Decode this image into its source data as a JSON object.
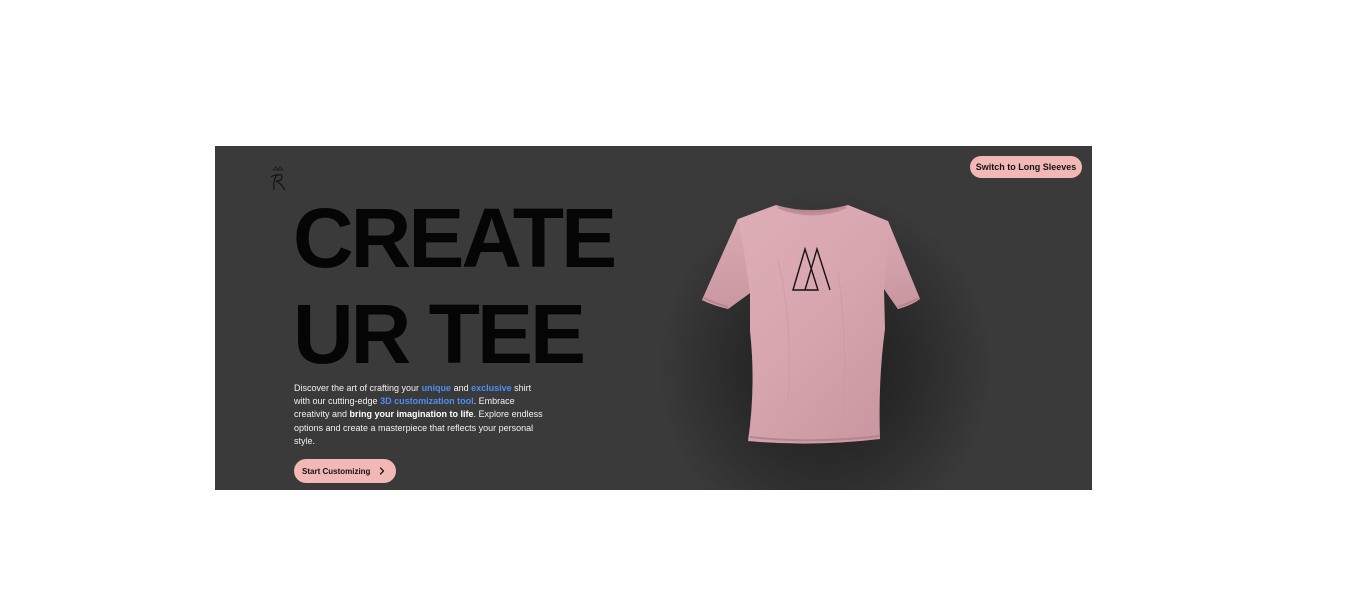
{
  "hero": {
    "headline_line1": "CREATE",
    "headline_line2": "UR TEE",
    "description": {
      "p1": "Discover the art of crafting your ",
      "unique": "unique",
      "p2": " and ",
      "exclusive": "exclusive",
      "p3": " shirt with our cutting-edge ",
      "tool": "3D customization tool",
      "p4": ". Embrace creativity and ",
      "imagination": "bring your imagination to life",
      "p5": ". Explore endless options and create a masterpiece that reflects your personal style."
    },
    "cta_label": "Start Customizing"
  },
  "toolbar": {
    "switch_label": "Switch to Long Sleeves"
  },
  "icons": {
    "logo": "r-logo-icon",
    "cta_icon": "chevron-right-icon",
    "shirt_decal": "triangle-logo-icon"
  },
  "colors": {
    "background": "#3a3a3b",
    "shirt": "#d9a8b0",
    "accent_pink": "#f2b8b6",
    "highlight_blue": "#4d8ef5",
    "headline": "#050505"
  }
}
